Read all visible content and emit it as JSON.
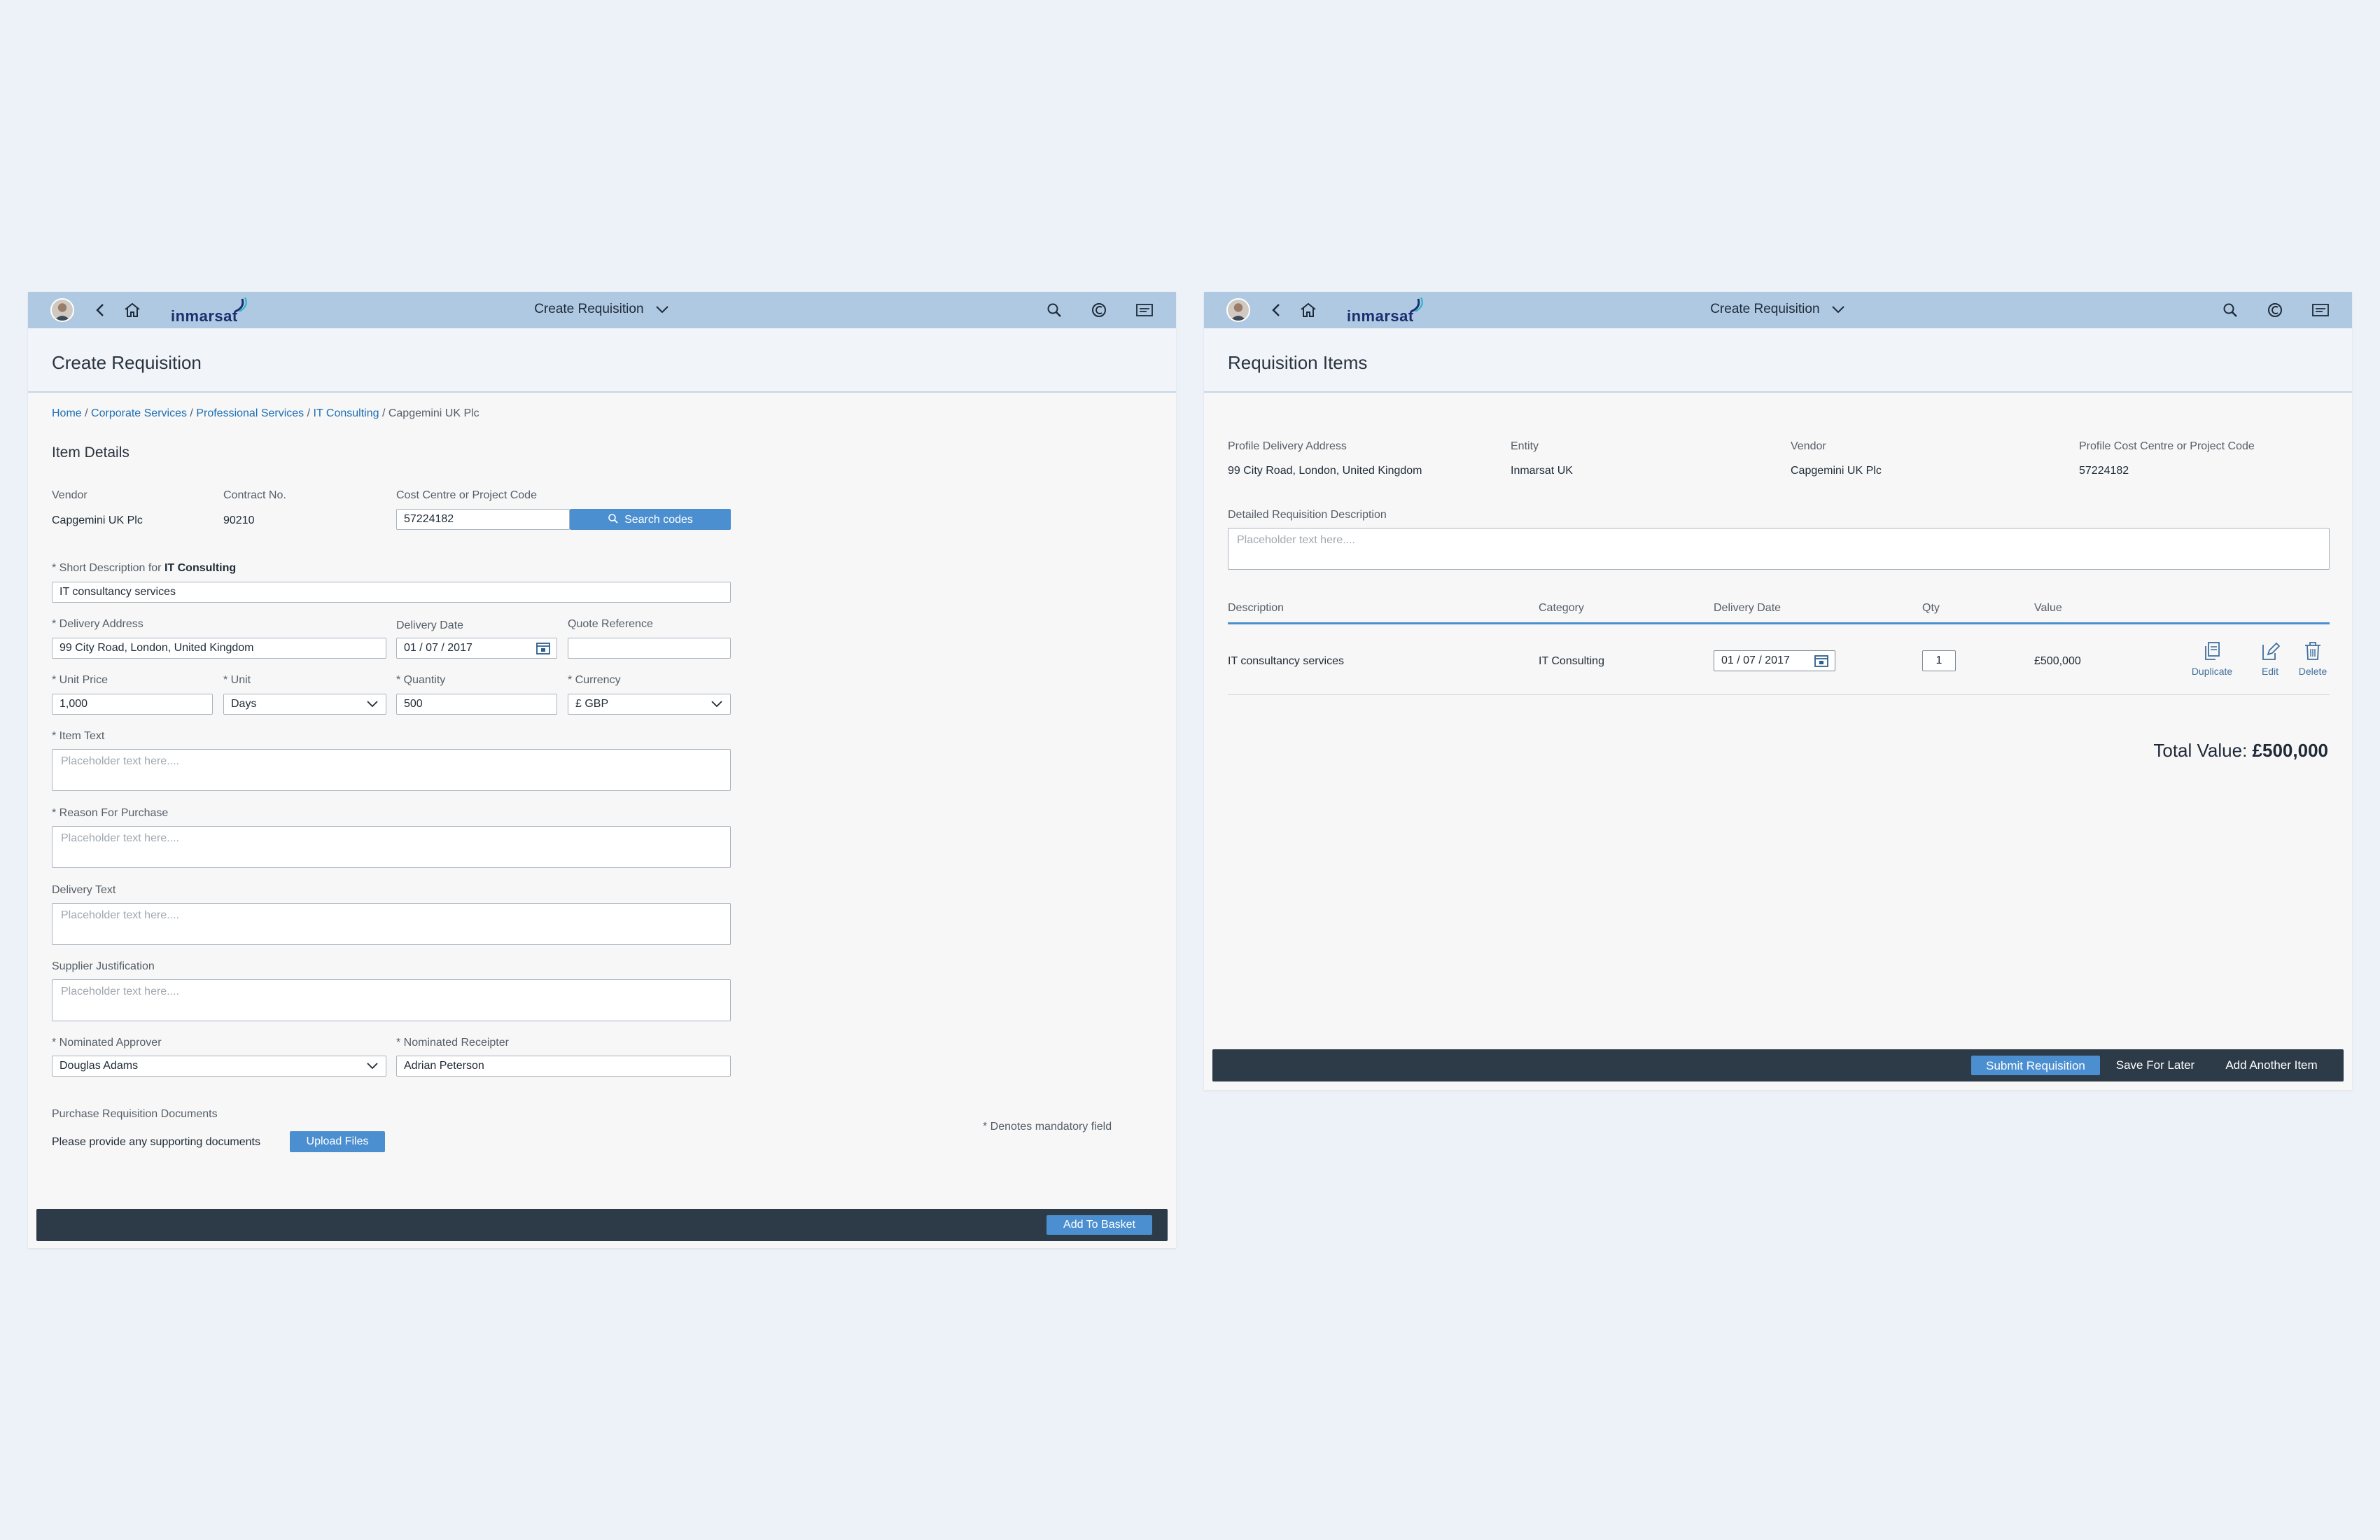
{
  "shell": {
    "title": "Create Requisition",
    "logo": "inmarsat",
    "icons": [
      "avatar",
      "back-icon",
      "home-icon",
      "search-icon",
      "copilot-icon",
      "menu-icon",
      "chevron-down-icon"
    ]
  },
  "left": {
    "page_title": "Create Requisition",
    "breadcrumb": [
      "Home",
      "Corporate Services",
      "Professional Services",
      "IT Consulting",
      "Capgemini UK Plc"
    ],
    "breadcrumb_sep": " / ",
    "section_title": "Item Details",
    "vendor_label": "Vendor",
    "vendor_value": "Capgemini UK Plc",
    "contract_label": "Contract No.",
    "contract_value": "90210",
    "cost_centre_label": "Cost Centre or Project Code",
    "cost_centre_value": "57224182",
    "search_codes_label": "Search codes",
    "short_desc_prefix": "* Short Description for ",
    "short_desc_category": "IT Consulting",
    "short_desc_value": "IT consultancy services",
    "delivery_address_label": "* Delivery Address",
    "delivery_address_value": "99 City Road, London, United Kingdom",
    "delivery_date_label": "Delivery Date",
    "delivery_date_value": "01 / 07 / 2017",
    "quote_ref_label": "Quote Reference",
    "quote_ref_value": "",
    "unit_price_label": "* Unit Price",
    "unit_price_value": "1,000",
    "unit_label": "* Unit",
    "unit_value": "Days",
    "quantity_label": "* Quantity",
    "quantity_value": "500",
    "currency_label": "* Currency",
    "currency_value": "£ GBP",
    "item_text_label": "* Item Text",
    "item_text_placeholder": "Placeholder text here....",
    "reason_label": "* Reason For Purchase",
    "reason_placeholder": "Placeholder text here....",
    "delivery_text_label": "Delivery Text",
    "delivery_text_placeholder": "Placeholder text here....",
    "supplier_just_label": "Supplier Justification",
    "supplier_just_placeholder": "Placeholder text here....",
    "approver_label": "* Nominated Approver",
    "approver_value": "Douglas Adams",
    "receipter_label": "* Nominated Receipter",
    "receipter_value": "Adrian Peterson",
    "docs_title": "Purchase Requisition Documents",
    "docs_text": "Please provide any supporting documents",
    "upload_label": "Upload Files",
    "mandatory_note": "* Denotes mandatory field",
    "add_to_basket_label": "Add To Basket"
  },
  "right": {
    "page_title": "Requisition Items",
    "profile_address_label": "Profile Delivery Address",
    "profile_address_value": "99 City Road, London, United Kingdom",
    "entity_label": "Entity",
    "entity_value": "Inmarsat UK",
    "vendor_label": "Vendor",
    "vendor_value": "Capgemini UK Plc",
    "profile_cost_label": "Profile Cost Centre or Project Code",
    "profile_cost_value": "57224182",
    "detailed_desc_label": "Detailed Requisition Description",
    "detailed_desc_placeholder": "Placeholder text here....",
    "table": {
      "headers": [
        "Description",
        "Category",
        "Delivery Date",
        "Qty",
        "Value"
      ],
      "rows": [
        {
          "description": "IT consultancy services",
          "category": "IT Consulting",
          "delivery_date": "01 / 07 / 2017",
          "qty": "1",
          "value": "£500,000"
        }
      ],
      "actions": [
        "Duplicate",
        "Edit",
        "Delete"
      ]
    },
    "total_label": "Total Value: ",
    "total_value": "£500,000",
    "submit_label": "Submit Requisition",
    "save_later_label": "Save For Later",
    "add_another_label": "Add Another Item"
  },
  "colors": {
    "shellbar": "#afc9e3",
    "accent": "#4b8fd0",
    "footer": "#2d3a48",
    "link": "#1b6fb5",
    "background": "#edf1f8"
  }
}
